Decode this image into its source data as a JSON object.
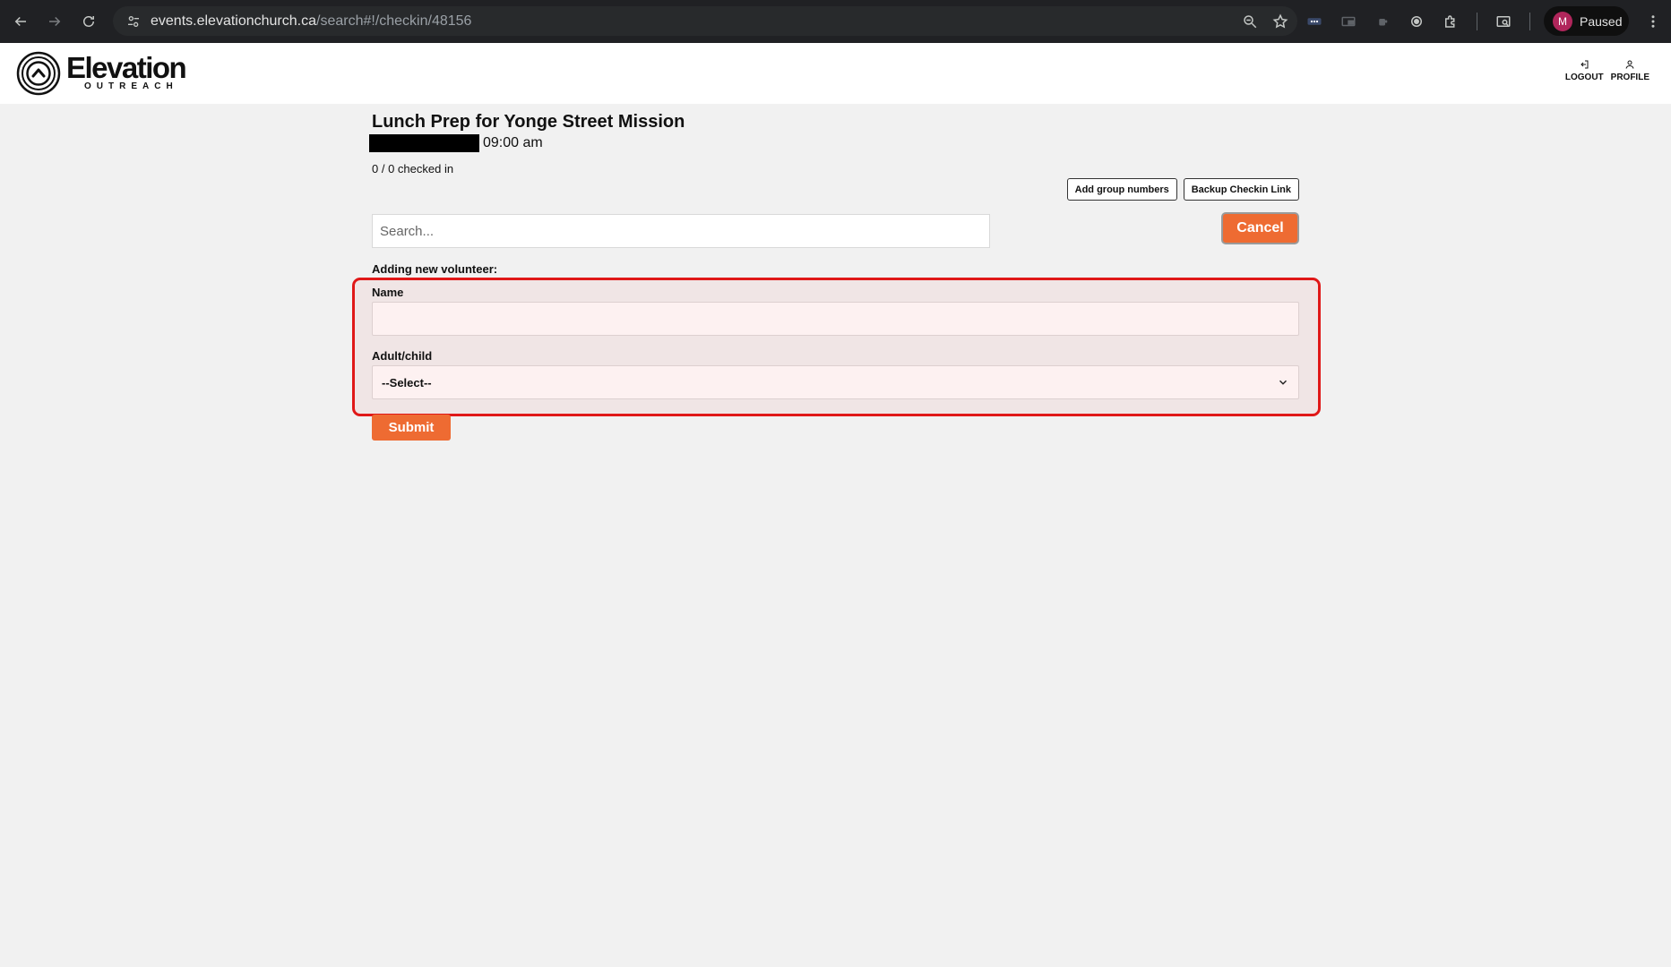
{
  "browser": {
    "url_host": "events.elevationchurch.ca",
    "url_path": "/search#!/checkin/48156",
    "profile_initial": "M",
    "profile_status": "Paused"
  },
  "site": {
    "logo_word": "Elevation",
    "logo_sub": "OUTREACH",
    "logout_label": "LOGOUT",
    "profile_label": "PROFILE"
  },
  "event": {
    "title": "Lunch Prep for Yonge Street Mission",
    "time": "09:00 am",
    "checked_in": "0 / 0 checked in"
  },
  "actions": {
    "add_group_label": "Add group numbers",
    "backup_link_label": "Backup Checkin Link",
    "cancel_label": "Cancel"
  },
  "search": {
    "placeholder": "Search..."
  },
  "form": {
    "heading": "Adding new volunteer:",
    "name_label": "Name",
    "name_value": "",
    "adult_child_label": "Adult/child",
    "adult_child_selected": "--Select--",
    "submit_label": "Submit"
  },
  "colors": {
    "accent": "#ee6b32",
    "highlight_border": "#e01818"
  }
}
